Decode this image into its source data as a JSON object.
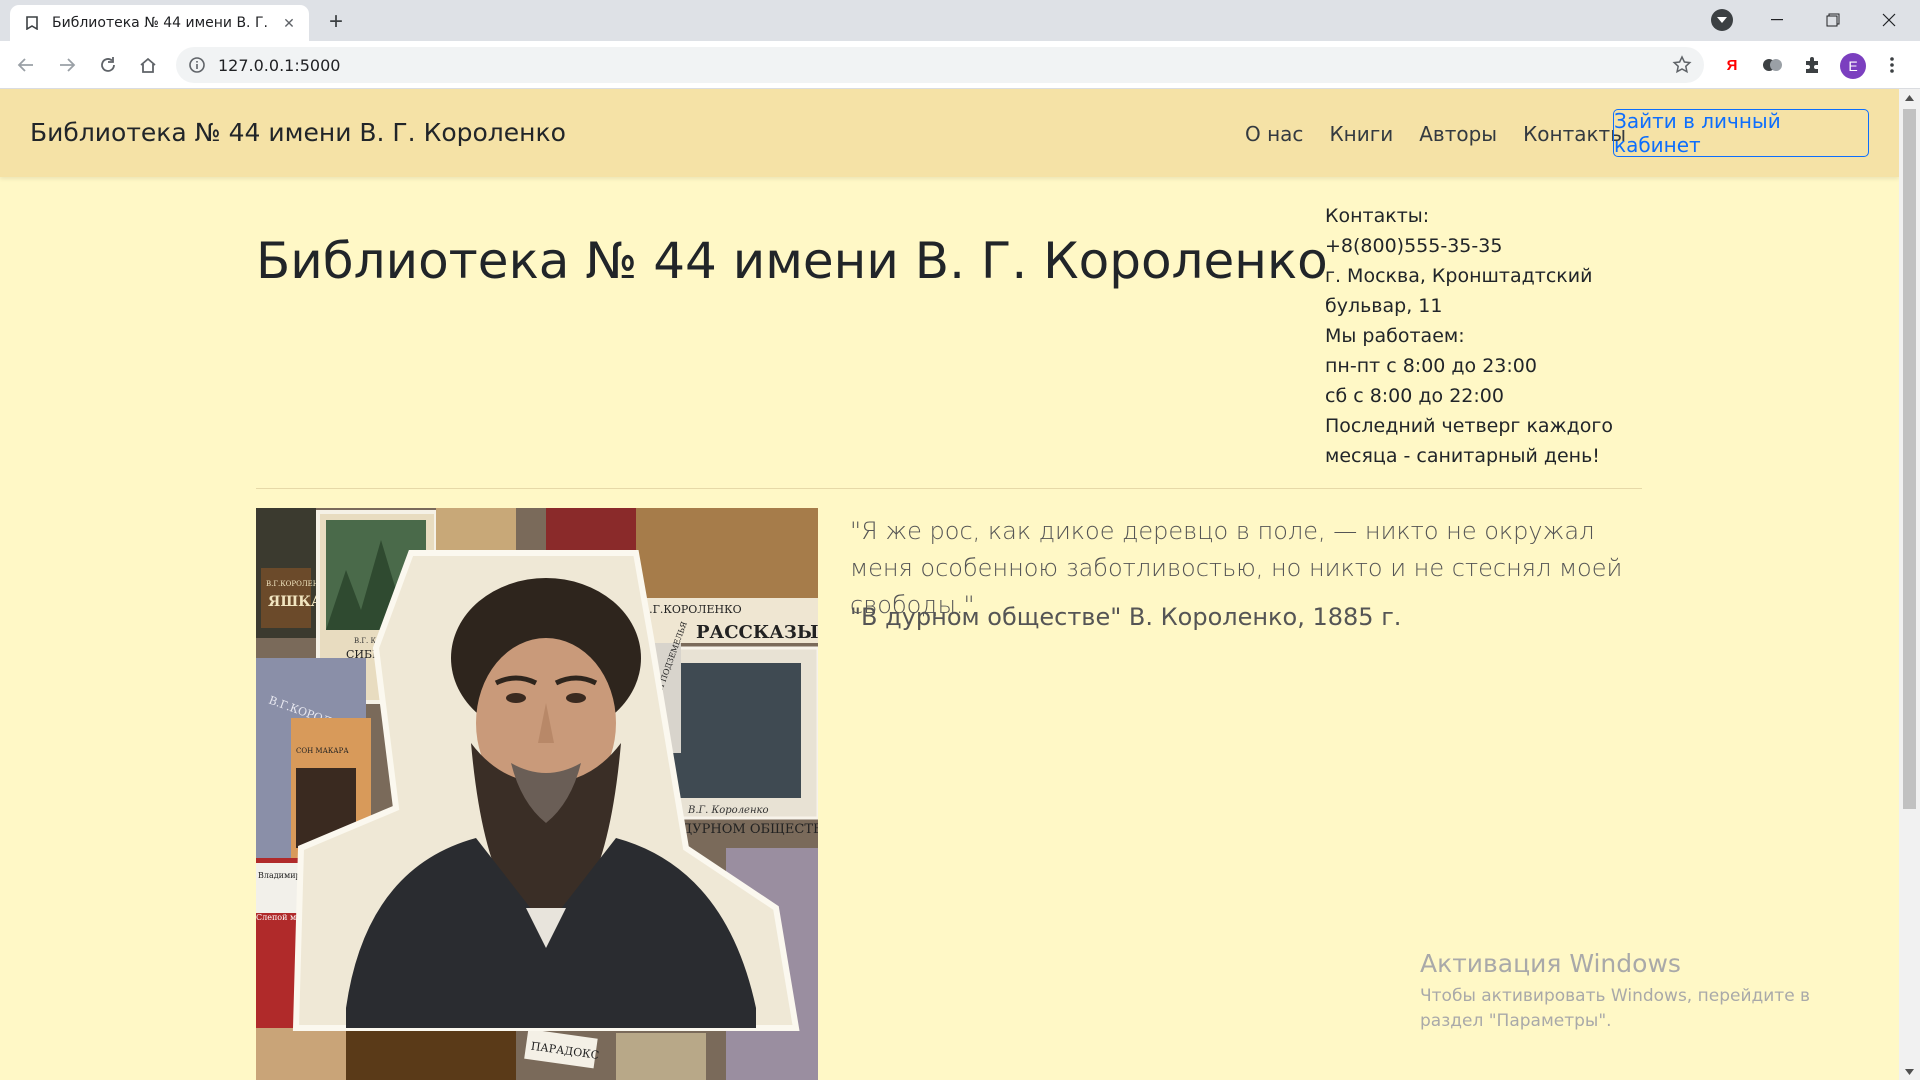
{
  "browser": {
    "tab_title": "Библиотека № 44 имени В. Г. Короленко",
    "tab_close": "✕",
    "new_tab": "+",
    "url": "127.0.0.1:5000",
    "avatar_letter": "E",
    "ext_ya_label": "Я"
  },
  "navbar": {
    "brand": "Библиотека № 44 имени В. Г. Короленко",
    "links": [
      "О нас",
      "Книги",
      "Авторы",
      "Контакты"
    ],
    "login_label": "Зайти в личный кабинет"
  },
  "main": {
    "title": "Библиотека № 44 имени В. Г. Короленко",
    "contacts": [
      "Контакты:",
      "+8(800)555-35-35",
      "г. Москва, Кронштадтский бульвар, 11",
      "Мы работаем:",
      "пн-пт с 8:00 до 23:00",
      "сб с 8:00 до 22:00",
      "Последний четверг каждого месяца - санитарный день!"
    ],
    "quote": "\"Я же рос, как дикое деревцо в поле, — никто не окружал меня особенною заботливостью, но никто и не стеснял моей свободы.\"",
    "quote_source": "\"В дурном обществе\" В. Короленко, 1885 г.",
    "portrait_texts": {
      "book1": "В.Г.КОРОЛЕНКО",
      "book1b": "ЯШКА",
      "book2": "В.Г. КОРОЛЕНКО",
      "book2b": "СИБИРСКИЕ РАССКАЗЫ",
      "book3": "В.Г.КОРОЛЕНКО",
      "book3b": "РАССКАЗЫ",
      "book4": "В.Г. Короленко",
      "book4b": "В ДУРНОМ ОБЩЕСТВЕ",
      "book5": "В.Г.КОРОЛЕНКО",
      "book5b": "СОН МАКАРА",
      "book6": "ДЕТИ ПОДЗЕМЕЛЬЯ",
      "book7": "Владимир Короленко",
      "book7b": "Слепой музыкант",
      "book8": "ПАРАДОКС",
      "book9": "РАССКАЗЫ"
    }
  },
  "watermark": {
    "title": "Активация Windows",
    "subtitle": "Чтобы активировать Windows, перейдите в раздел \"Параметры\"."
  },
  "colors": {
    "page_bg": "#fff8c6",
    "navbar_bg": "#f5e2a6",
    "login_accent": "#0d6efd"
  }
}
